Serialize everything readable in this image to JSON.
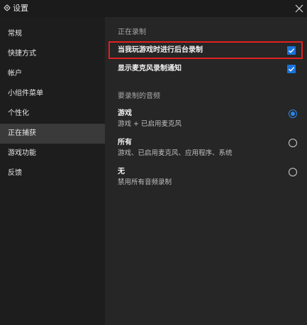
{
  "window": {
    "title": "设置"
  },
  "sidebar": {
    "items": [
      {
        "label": "常规"
      },
      {
        "label": "快捷方式"
      },
      {
        "label": "帐户"
      },
      {
        "label": "小组件菜单"
      },
      {
        "label": "个性化"
      },
      {
        "label": "正在捕获",
        "selected": true
      },
      {
        "label": "游戏功能"
      },
      {
        "label": "反馈"
      }
    ]
  },
  "content": {
    "recording_heading": "正在录制",
    "options": [
      {
        "label": "当我玩游戏时进行后台录制",
        "checked": true
      },
      {
        "label": "显示麦克风录制通知",
        "checked": true
      }
    ],
    "audio_heading": "要录制的音频",
    "audio_options": [
      {
        "title": "游戏",
        "subtitle": "游戏 + 已启用麦克风",
        "selected": true
      },
      {
        "title": "所有",
        "subtitle": "游戏、已启用麦克风、应用程序、系统",
        "selected": false
      },
      {
        "title": "无",
        "subtitle": "禁用所有音频录制",
        "selected": false
      }
    ]
  },
  "colors": {
    "accent": "#1a73d9",
    "highlight_border": "#e02020",
    "selected_nav": "#3a3a3a"
  },
  "icons": {
    "title": "gear-icon",
    "close": "close-icon",
    "checkbox": "checkmark-icon"
  }
}
